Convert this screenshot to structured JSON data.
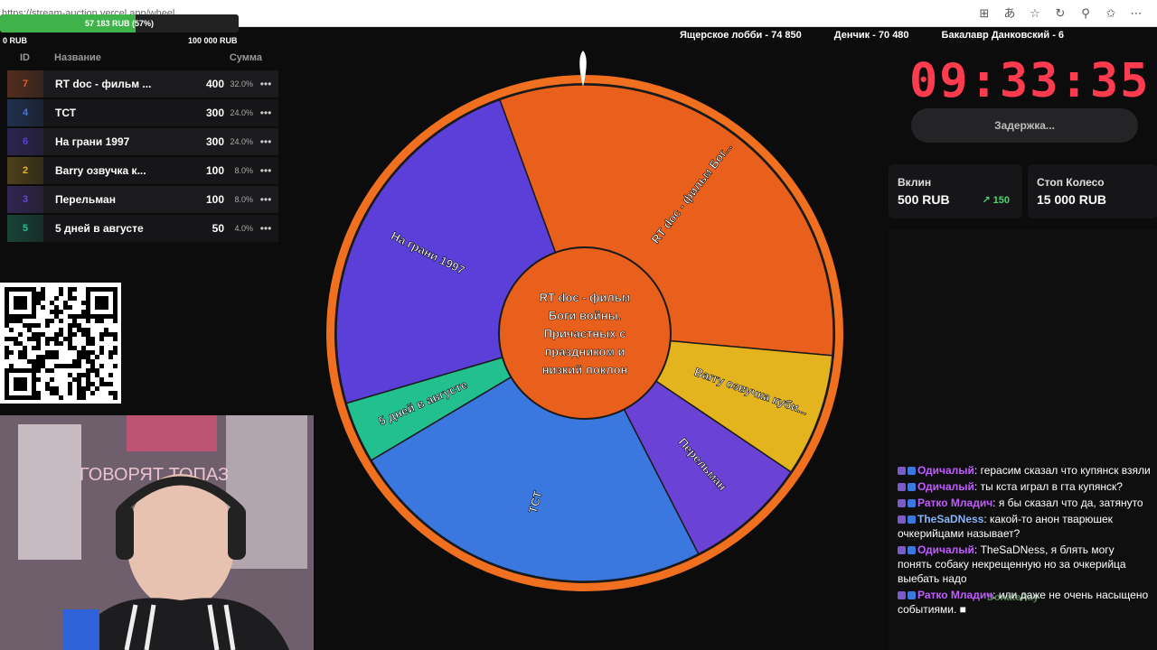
{
  "browser": {
    "url": "https://stream-auction.vercel.app/wheel"
  },
  "progress": {
    "label": "57 183 RUB (57%)",
    "fraction": 0.57,
    "min_label": "0 RUB",
    "max_label": "100 000 RUB",
    "color": "#3fb34a"
  },
  "lots": {
    "headers": {
      "id": "ID",
      "name": "Название",
      "sum": "Сумма"
    },
    "rows": [
      {
        "id": "7",
        "name": "RT doc - фильм ...",
        "amount": "400",
        "percent": "32.0%",
        "color": "#e8601c"
      },
      {
        "id": "4",
        "name": "ТСТ",
        "amount": "300",
        "percent": "24.0%",
        "color": "#3a78e0"
      },
      {
        "id": "6",
        "name": "На грани 1997",
        "amount": "300",
        "percent": "24.0%",
        "color": "#5a3fd8"
      },
      {
        "id": "2",
        "name": "Barry озвучка к...",
        "amount": "100",
        "percent": "8.0%",
        "color": "#e3b41e"
      },
      {
        "id": "3",
        "name": "Перельман",
        "amount": "100",
        "percent": "8.0%",
        "color": "#6a43d6"
      },
      {
        "id": "5",
        "name": "5 дней в августе",
        "amount": "50",
        "percent": "4.0%",
        "color": "#23c08f"
      }
    ],
    "menu_glyph": "•••"
  },
  "ticker": [
    "Ящерское лобби - 74 850",
    "Денчик - 70 480",
    "Бакалавр Данковский - 6"
  ],
  "wheel": {
    "center_text": "RT doc - фильм Боги войны. Причастных с праздником и низкий поклон",
    "slices": [
      {
        "label": "RT doc - фильм Бог...",
        "percent": 32,
        "color": "#e8601c"
      },
      {
        "label": "Barry озвучка куби...",
        "percent": 8,
        "color": "#e3b41e"
      },
      {
        "label": "Перельман",
        "percent": 8,
        "color": "#6a43d6"
      },
      {
        "label": "ТСТ",
        "percent": 24,
        "color": "#3a78e0"
      },
      {
        "label": "5 дней в августе",
        "percent": 4,
        "color": "#23c08f"
      },
      {
        "label": "На грани 1997",
        "percent": 24,
        "color": "#5a3fd8"
      }
    ],
    "rim_color": "#f07020"
  },
  "timer": {
    "value": "09:33:35",
    "color": "#ff3b50"
  },
  "delay_button": "Задержка...",
  "stats": {
    "bet_label": "Вклин",
    "bet_value": "500 RUB",
    "bet_delta": "150",
    "stop_label": "Стоп Колесо",
    "stop_value": "15 000 RUB"
  },
  "chat": [
    {
      "author": "Одичалый",
      "color": "#c05cff",
      "text": "герасим сказал что купянск взяли"
    },
    {
      "author": "Одичалый",
      "color": "#c05cff",
      "text": "ты кста играл в гта купянск?"
    },
    {
      "author": "Ратко Младич",
      "color": "#c05cff",
      "text": "я бы сказал что да, затянуто"
    },
    {
      "author": "TheSaDNess",
      "color": "#8ab4f8",
      "text": "какой-то анон тварюшек очкерийцами называет?"
    },
    {
      "author": "Одичалый",
      "color": "#c05cff",
      "text": "TheSaDNess, я блять могу понять собаку некрещенную но за очкерийца выебать надо"
    },
    {
      "author": "Ратко Младич",
      "color": "#c05cff",
      "text": "или даже не очень насыщено событиями. ■"
    }
  ],
  "donatepay_label": "DonatePay"
}
